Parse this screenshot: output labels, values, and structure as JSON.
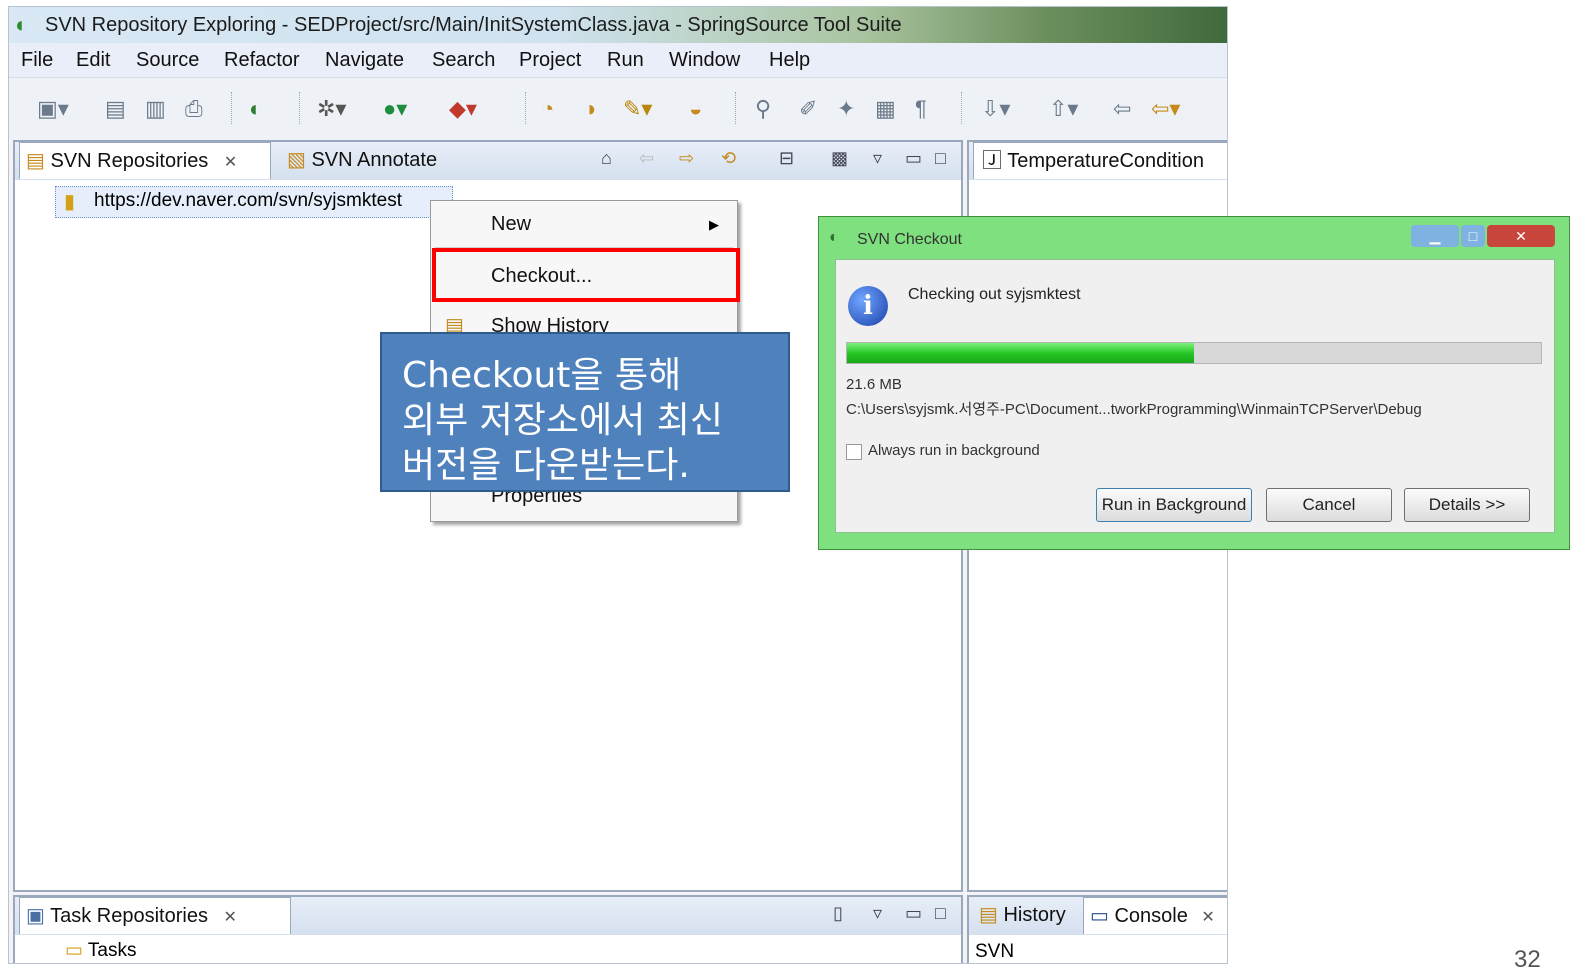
{
  "window": {
    "title": "SVN Repository Exploring - SEDProject/src/Main/InitSystemClass.java - SpringSource Tool Suite"
  },
  "menubar": [
    "File",
    "Edit",
    "Source",
    "Refactor",
    "Navigate",
    "Search",
    "Project",
    "Run",
    "Window",
    "Help"
  ],
  "left_view": {
    "tabs": [
      {
        "label": "SVN Repositories",
        "close": "✕"
      },
      {
        "label": "SVN Annotate"
      }
    ],
    "repository_url": "https://dev.naver.com/svn/syjsmktest"
  },
  "right_view": {
    "tab": "TemperatureCondition"
  },
  "context_menu": {
    "items": [
      "New",
      "Checkout...",
      "Show History",
      "Properties"
    ],
    "submenu_arrow": "▶"
  },
  "callout": {
    "lines": [
      "Checkout을 통해",
      "외부 저장소에서 최신",
      "버전을 다운받는다."
    ]
  },
  "dialog": {
    "title": "SVN Checkout",
    "message": "Checking out syjsmktest",
    "progress": 0.5,
    "size": "21.6 MB",
    "path": "C:\\Users\\syjsmk.서영주-PC\\Document...tworkProgramming\\WinmainTCPServer\\Debug",
    "checkbox_label": "Always run in background",
    "buttons": [
      "Run in Background",
      "Cancel",
      "Details >>"
    ]
  },
  "bottom_left_view": {
    "tab": "Task Repositories",
    "close": "✕",
    "item": "Tasks"
  },
  "bottom_right_view": {
    "tabs": [
      "History",
      "Console"
    ],
    "close": "✕",
    "content": "SVN"
  },
  "page_number": "32",
  "colors": {
    "highlight": "#ff0000",
    "callout_bg": "#4f81bd",
    "dialog_frame": "#7ee07e",
    "progress": "#22c422"
  }
}
